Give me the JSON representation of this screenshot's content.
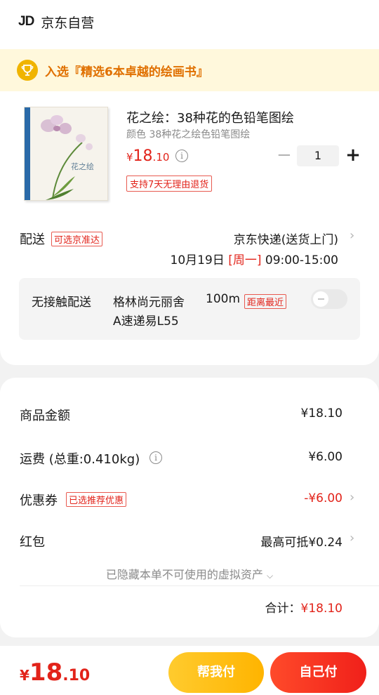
{
  "store": {
    "logo_text": "JD",
    "name": "京东自营"
  },
  "promo_banner": {
    "text": "入选『精选6本卓越的绘画书』",
    "icon": "trophy-icon"
  },
  "product": {
    "title": "花之绘：38种花的色铅笔图绘",
    "variant": "颜色 38种花之绘色铅笔图绘",
    "price_currency": "¥",
    "price_integer": "18",
    "price_decimal": ".10",
    "return_policy": "支持7天无理由退货",
    "quantity": "1",
    "qty_minus": "−",
    "qty_plus": "+",
    "cover_title": "花之绘"
  },
  "delivery": {
    "label": "配送",
    "tag": "可选京准达",
    "method": "京东快递(送货上门)",
    "date": "10月19日",
    "weekday": "[周一]",
    "time": "09:00-15:00"
  },
  "contactless": {
    "label": "无接触配送",
    "location": "格林尚元丽舍",
    "distance": "100m",
    "nearest_tag": "距离最近",
    "locker": "A速递易L55",
    "enabled": false
  },
  "summary": {
    "goods_label": "商品金额",
    "goods_value": "¥18.10",
    "freight_label": "运费 (总重:0.410kg)",
    "freight_value": "¥6.00",
    "coupon_label": "优惠券",
    "coupon_tag": "已选推荐优惠",
    "coupon_value": "-¥6.00",
    "redpacket_label": "红包",
    "redpacket_value": "最高可抵¥0.24",
    "hidden_assets": "已隐藏本单不可使用的虚拟资产",
    "subtotal_label": "合计：",
    "subtotal_value": "¥18.10"
  },
  "bottom_bar": {
    "total_currency": "¥",
    "total_integer": "18",
    "total_decimal": ".10",
    "help_pay": "帮我付",
    "self_pay": "自己付"
  },
  "colors": {
    "accent_red": "#e2231a",
    "banner_orange": "#e07000",
    "help_yellow": "#ffb400"
  }
}
